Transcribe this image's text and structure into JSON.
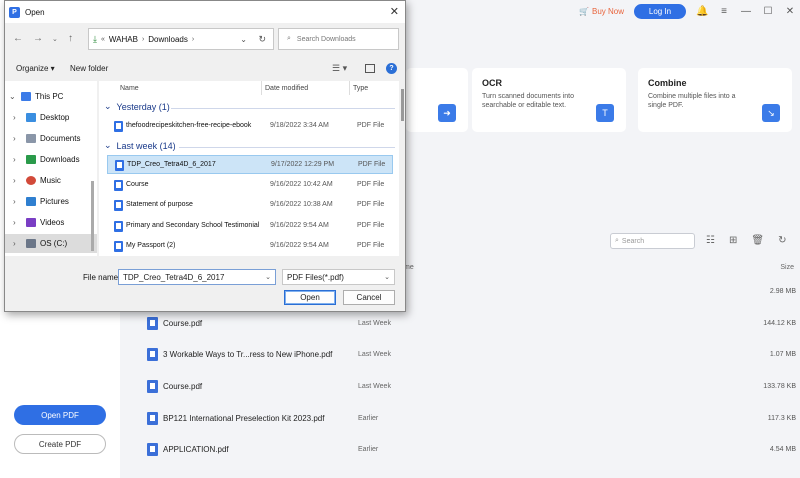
{
  "app": {
    "buy_now": "Buy Now",
    "login": "Log In",
    "open_pdf": "Open PDF",
    "create_pdf": "Create PDF",
    "accent": "#2f6fe4",
    "cards": {
      "ocr": {
        "title": "OCR",
        "desc": "Turn scanned documents into searchable or editable text."
      },
      "combine": {
        "title": "Combine",
        "desc": "Combine multiple files into a single PDF."
      }
    },
    "file_search_placeholder": "Search",
    "col_name_partial": "me",
    "col_size": "Size",
    "files": [
      {
        "name": "",
        "date": "",
        "size": "2.98 MB"
      },
      {
        "name": "Course.pdf",
        "date": "Last Week",
        "size": "144.12 KB"
      },
      {
        "name": "3 Workable Ways to Tr...ress to New iPhone.pdf",
        "date": "Last Week",
        "size": "1.07 MB"
      },
      {
        "name": "Course.pdf",
        "date": "Last Week",
        "size": "133.78 KB"
      },
      {
        "name": "BP121 International Preselection Kit 2023.pdf",
        "date": "Earlier",
        "size": "117.3 KB"
      },
      {
        "name": "APPLICATION.pdf",
        "date": "Earlier",
        "size": "4.54 MB"
      }
    ]
  },
  "dialog": {
    "title": "Open",
    "path": {
      "prefix": "«",
      "parent": "WAHAB",
      "current": "Downloads"
    },
    "search_placeholder": "Search Downloads",
    "organize": "Organize ▾",
    "new_folder": "New folder",
    "nav": [
      {
        "label": "This PC",
        "icon": "pc-icon"
      },
      {
        "label": "Desktop",
        "icon": "desktop-icon"
      },
      {
        "label": "Documents",
        "icon": "documents-icon"
      },
      {
        "label": "Downloads",
        "icon": "downloads-icon"
      },
      {
        "label": "Music",
        "icon": "music-icon"
      },
      {
        "label": "Pictures",
        "icon": "pictures-icon"
      },
      {
        "label": "Videos",
        "icon": "videos-icon"
      },
      {
        "label": "OS (C:)",
        "icon": "drive-icon"
      }
    ],
    "columns": {
      "name": "Name",
      "date": "Date modified",
      "type": "Type"
    },
    "groups": [
      {
        "label": "Yesterday (1)"
      },
      {
        "label": "Last week (14)"
      }
    ],
    "rows": [
      {
        "name": "thefoodrecipeskitchen-free-recipe-ebook",
        "date": "9/18/2022 3:34 AM",
        "type": "PDF File"
      },
      {
        "name": "TDP_Creo_Tetra4D_6_2017",
        "date": "9/17/2022 12:29 PM",
        "type": "PDF File"
      },
      {
        "name": "Course",
        "date": "9/16/2022 10:42 AM",
        "type": "PDF File"
      },
      {
        "name": "Statement of purpose",
        "date": "9/16/2022 10:38 AM",
        "type": "PDF File"
      },
      {
        "name": "Primary and Secondary School Testimonial",
        "date": "9/16/2022 9:54 AM",
        "type": "PDF File"
      },
      {
        "name": "My Passport (2)",
        "date": "9/16/2022 9:54 AM",
        "type": "PDF File"
      }
    ],
    "file_name_label": "File name:",
    "file_name_value": "TDP_Creo_Tetra4D_6_2017",
    "file_type": "PDF Files(*.pdf)",
    "open_btn": "Open",
    "cancel_btn": "Cancel"
  }
}
